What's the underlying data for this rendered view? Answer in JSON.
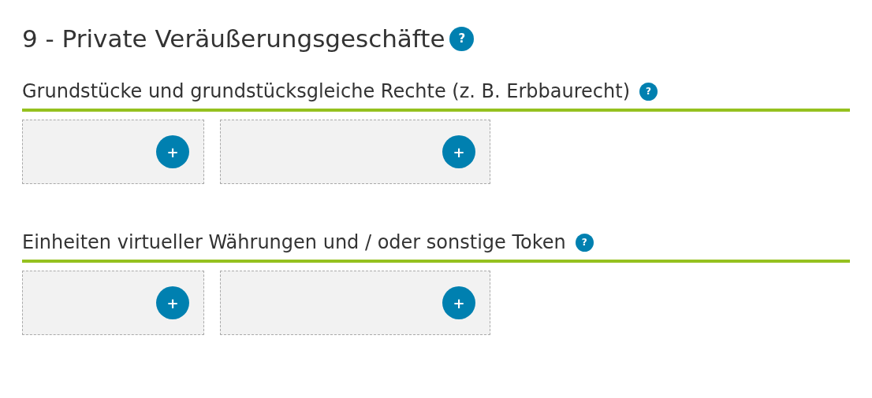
{
  "title": "9 - Private Veräußerungsgeschäfte",
  "title_help": "?",
  "sections": [
    {
      "heading": "Grundstücke und grundstücksgleiche Rechte (z. B. Erbbaurecht)",
      "help": "?",
      "cards": [
        {
          "button": "+"
        },
        {
          "button": "+"
        }
      ]
    },
    {
      "heading": "Einheiten virtueller Währungen und / oder sonstige Token",
      "help": "?",
      "cards": [
        {
          "button": "+"
        },
        {
          "button": "+"
        }
      ]
    }
  ]
}
